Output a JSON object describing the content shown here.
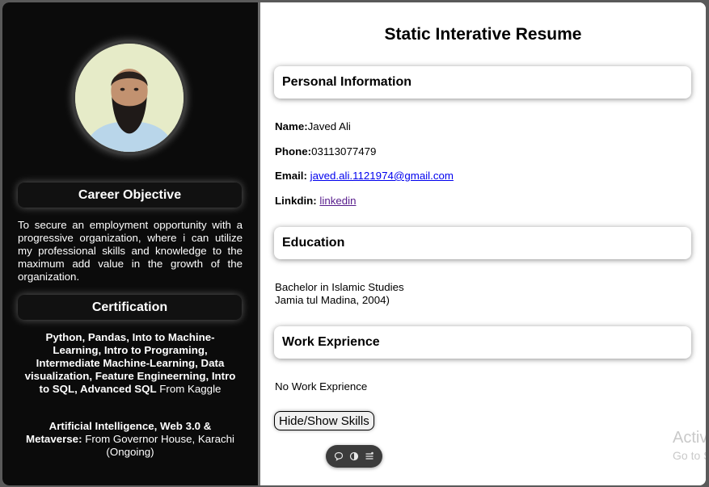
{
  "sidebar": {
    "career_title": "Career Objective",
    "objective": "To secure an employment opportunity with a progressive organization, where i can utilize my professional skills and knowledge to the maximum add value in the growth of the organization.",
    "cert_title": "Certification",
    "cert1_bold": "Python, Pandas, Into to Machine-Learning, Intro to Programing, Intermediate Machine-Learning, Data visualization, Feature Engineerning, Intro to SQL, Advanced SQL",
    "cert1_tail": " From Kaggle",
    "cert2_bold": "Artificial Intelligence, Web 3.0 & Metaverse:",
    "cert2_tail": " From Governor House, Karachi (Ongoing)"
  },
  "main": {
    "title": "Static Interative Resume",
    "personal_title": "Personal Information",
    "name_label": "Name:",
    "name_value": "Javed Ali",
    "phone_label": "Phone:",
    "phone_value": "03113077479",
    "email_label": "Email:",
    "email_value": "javed.ali.1121974@gmail.com",
    "linkedin_label": "Linkdin:",
    "linkedin_value": "linkedin",
    "education_title": "Education",
    "education_line1": "Bachelor in Islamic Studies",
    "education_line2": "Jamia tul Madina, 2004)",
    "work_title": "Work Exprience",
    "work_text": "No Work Exprience",
    "skills_button": "Hide/Show Skills"
  },
  "watermark": {
    "line1": "Activ",
    "line2": "Go to S"
  },
  "icons": {
    "toolbar": [
      "chat-icon",
      "toggle-icon",
      "menu-icon"
    ]
  }
}
